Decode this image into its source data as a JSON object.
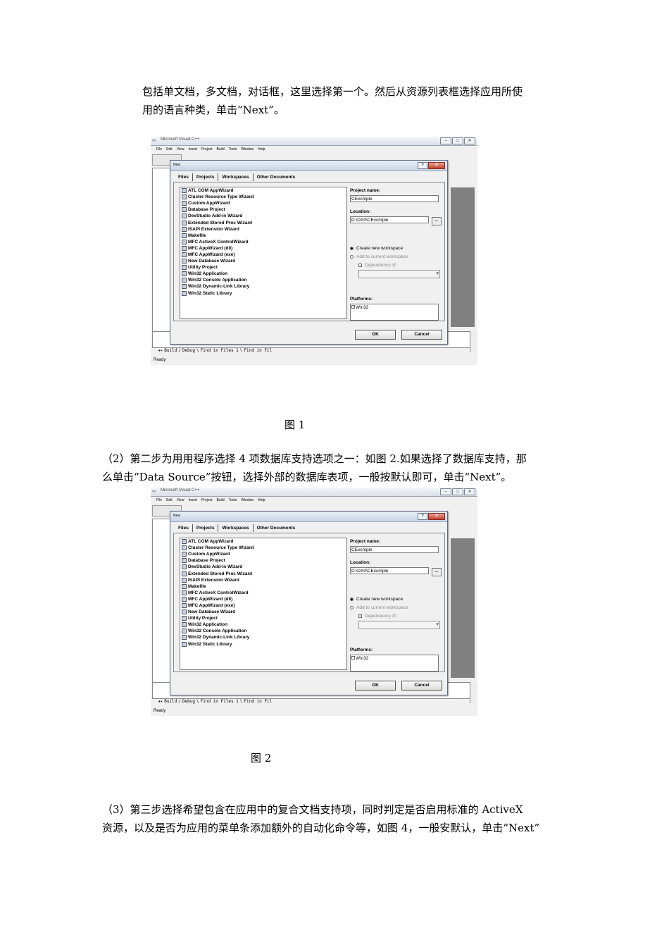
{
  "paragraphs": {
    "p1_line1": "包括单文档，多文档，对话框，这里选择第一个。然后从资源列表框选择应用所使",
    "p1_line2": "用的语言种类，单击“Next”。",
    "p2_line1": "（2）第二步为用用程序选择 4 项数据库支持选项之一：如图 2.如果选择了数据库支持，那",
    "p2_line2": "么单击“Data Source”按钮，选择外部的数据库表项，一般按默认即可，单击“Next”。",
    "p3_line1": "（3）第三步选择希望包含在应用中的复合文档支持项，同时判定是否启用标准的  ActiveX",
    "p3_line2": "资源，以及是否为应用的菜单条添加额外的自动化命令等，如图 4，一般安默认，单击“Next”"
  },
  "captions": {
    "fig1": "图 1",
    "fig2": "图 2"
  },
  "screenshot": {
    "app_title": "Microsoft Visual C++",
    "menu": [
      "File",
      "Edit",
      "View",
      "Insert",
      "Project",
      "Build",
      "Tools",
      "Window",
      "Help"
    ],
    "output_tabs": [
      "Build",
      "Debug",
      "Find in Files 1",
      "Find in Fil"
    ],
    "status": "Ready",
    "dialog": {
      "title": "New",
      "help_btn": "?",
      "close_btn": "✕",
      "tabs": [
        "Files",
        "Projects",
        "Workspaces",
        "Other Documents"
      ],
      "project_types": [
        "ATL COM AppWizard",
        "Cluster Resource Type Wizard",
        "Custom AppWizard",
        "Database Project",
        "DevStudio Add-in Wizard",
        "Extended Stored Proc Wizard",
        "ISAPI Extension Wizard",
        "Makefile",
        "MFC ActiveX ControlWizard",
        "MFC AppWizard (dll)",
        "MFC AppWizard (exe)",
        "New Database Wizard",
        "Utility Project",
        "Win32 Application",
        "Win32 Console Application",
        "Win32 Dynamic-Link Library",
        "Win32 Static Library"
      ],
      "project_name_label": "Project name:",
      "project_name_value": "CExcmple",
      "location_label": "Location:",
      "location_value": "D:\\DX0\\CExcmple",
      "browse": "...",
      "create_ws": "Create new workspace",
      "add_ws": "Add to current workspace",
      "dependency": "Dependency of:",
      "platforms_label": "Platforms:",
      "platform_item": "Win32",
      "ok": "OK",
      "cancel": "Cancel"
    }
  }
}
